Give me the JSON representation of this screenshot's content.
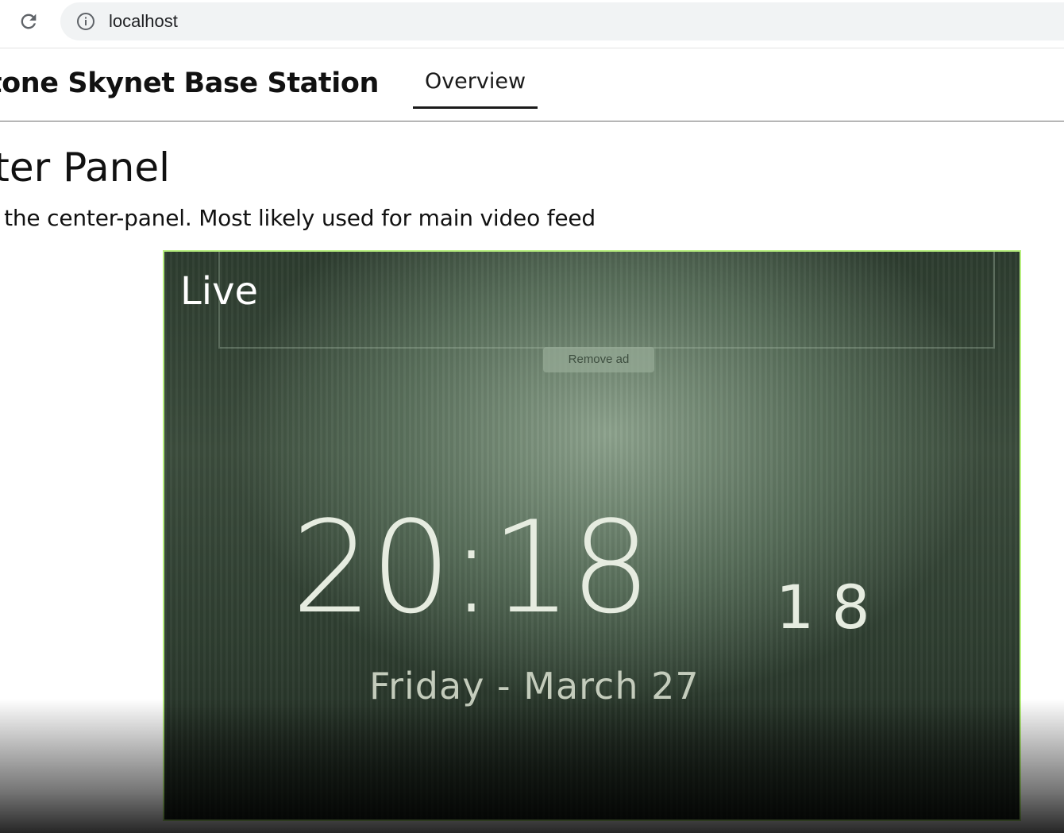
{
  "browser": {
    "url": "localhost",
    "reload_icon": "reload-icon",
    "info_icon": "info-icon"
  },
  "nav": {
    "title": "stone Skynet Base Station",
    "tabs": [
      {
        "label": "Overview",
        "active": true
      }
    ]
  },
  "main": {
    "heading": "ter Panel",
    "description": "the center-panel. Most likely used for main video feed"
  },
  "video": {
    "live_label": "Live",
    "ad_button": "Remove ad",
    "clock_time": "20:18",
    "clock_seconds": "18",
    "clock_date": "Friday - March 27",
    "border_color": "#b7ee7e"
  }
}
